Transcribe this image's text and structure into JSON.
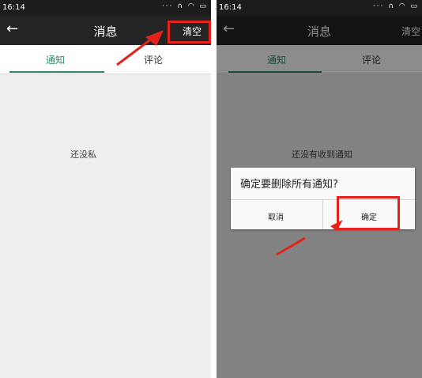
{
  "left": {
    "status_time": "16:14",
    "title": "消息",
    "clear_label": "清空",
    "tabs": [
      "通知",
      "评论"
    ],
    "empty_text": "还没私"
  },
  "right": {
    "status_time": "16:14",
    "title": "消息",
    "clear_label": "清空",
    "tabs": [
      "通知",
      "评论"
    ],
    "empty_text": "还没有收到通知",
    "dialog": {
      "message": "确定要删除所有通知?",
      "cancel_label": "取消",
      "confirm_label": "确定"
    }
  },
  "colors": {
    "accent": "#2e8b6f",
    "annotation": "#e3221d",
    "actionbar": "#242424"
  }
}
